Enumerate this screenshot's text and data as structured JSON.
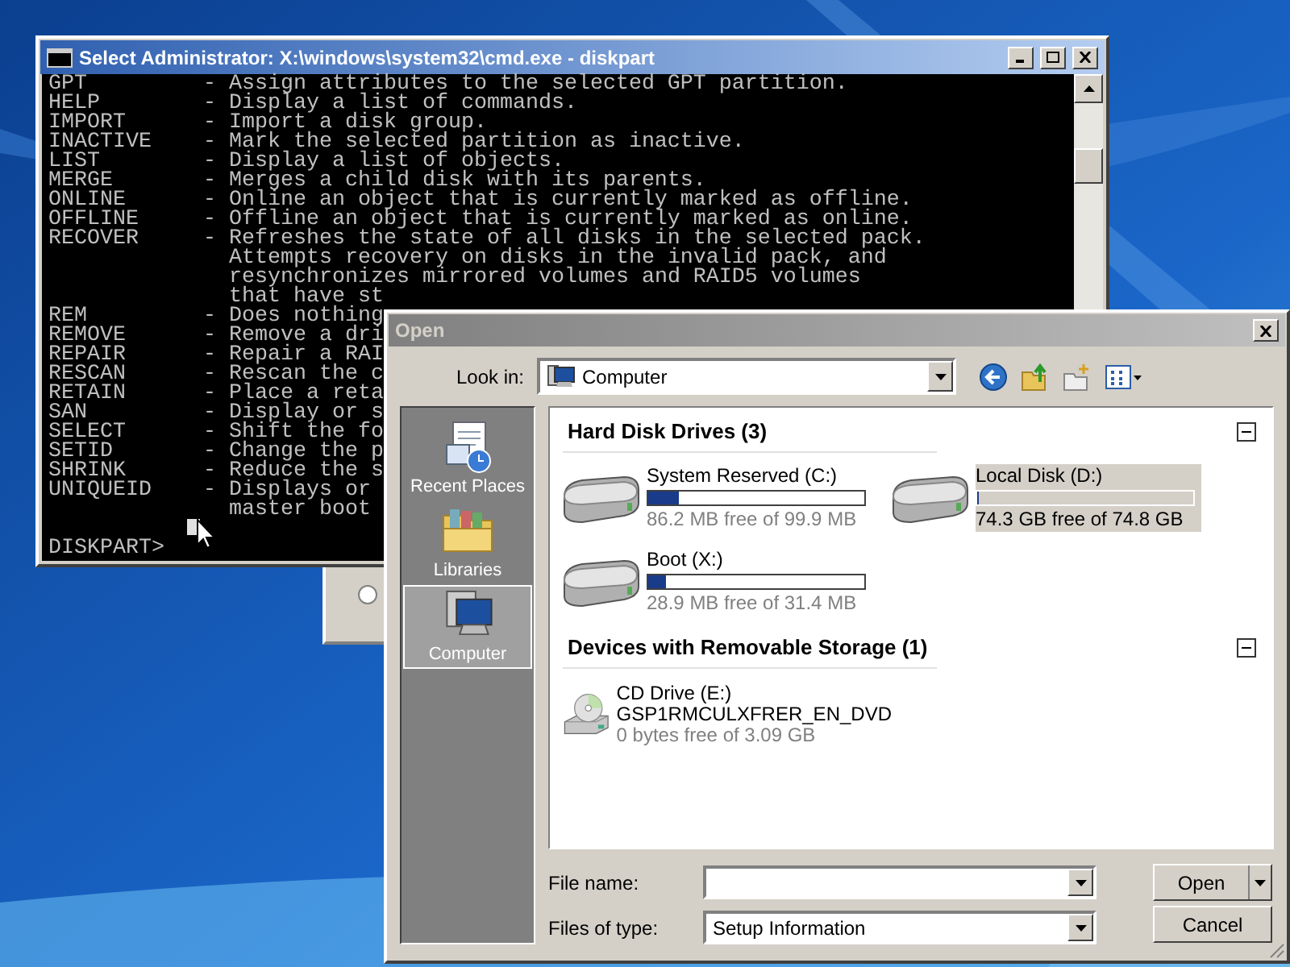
{
  "console": {
    "title": "Select Administrator: X:\\windows\\system32\\cmd.exe - diskpart",
    "lines": [
      {
        "command": "GPT",
        "text": "- Assign attributes to the selected GPT partition."
      },
      {
        "command": "HELP",
        "text": "- Display a list of commands."
      },
      {
        "command": "IMPORT",
        "text": "- Import a disk group."
      },
      {
        "command": "INACTIVE",
        "text": "- Mark the selected partition as inactive."
      },
      {
        "command": "LIST",
        "text": "- Display a list of objects."
      },
      {
        "command": "MERGE",
        "text": "- Merges a child disk with its parents."
      },
      {
        "command": "ONLINE",
        "text": "- Online an object that is currently marked as offline."
      },
      {
        "command": "OFFLINE",
        "text": "- Offline an object that is currently marked as online."
      },
      {
        "command": "RECOVER",
        "text": "- Refreshes the state of all disks in the selected pack."
      },
      {
        "text": "Attempts recovery on disks in the invalid pack, and"
      },
      {
        "text": "resynchronizes mirrored volumes and RAID5 volumes"
      },
      {
        "text": "that have st"
      },
      {
        "command": "REM",
        "text": "- Does nothing"
      },
      {
        "command": "REMOVE",
        "text": "- Remove a dri"
      },
      {
        "command": "REPAIR",
        "text": "- Repair a RAI"
      },
      {
        "command": "RESCAN",
        "text": "- Rescan the c"
      },
      {
        "command": "RETAIN",
        "text": "- Place a reta"
      },
      {
        "command": "SAN",
        "text": "- Display or s"
      },
      {
        "command": "SELECT",
        "text": "- Shift the fo"
      },
      {
        "command": "SETID",
        "text": "- Change the p"
      },
      {
        "command": "SHRINK",
        "text": "- Reduce the s"
      },
      {
        "command": "UNIQUEID",
        "text": "- Displays or"
      },
      {
        "text": "master boot"
      }
    ],
    "prompt": "DISKPART>"
  },
  "background_window": {
    "radio": {
      "selected": false
    }
  },
  "open_dialog": {
    "title": "Open",
    "look_in": {
      "label": "Look in:",
      "value": "Computer"
    },
    "places": [
      {
        "label": "Recent Places",
        "selected": false
      },
      {
        "label": "Libraries",
        "selected": false
      },
      {
        "label": "Computer",
        "selected": true
      }
    ],
    "groups": [
      {
        "heading": "Hard Disk Drives (3)",
        "expanded": true,
        "items": [
          {
            "kind": "hdd",
            "name": "System Reserved (C:)",
            "level": 0.14,
            "free": "86.2 MB free of 99.9 MB",
            "selected": false
          },
          {
            "kind": "hdd",
            "name": "Local Disk (D:)",
            "level": 0.01,
            "free": "74.3 GB free of 74.8 GB",
            "selected": true
          },
          {
            "kind": "hdd",
            "name": "Boot (X:)",
            "level": 0.08,
            "free": "28.9 MB free of 31.4 MB",
            "selected": false
          }
        ]
      },
      {
        "heading": "Devices with Removable Storage (1)",
        "expanded": true,
        "items": [
          {
            "kind": "cd",
            "name": "CD Drive (E:)",
            "label": "GSP1RMCULXFRER_EN_DVD",
            "free": "0 bytes free of 3.09 GB",
            "selected": false
          }
        ]
      }
    ],
    "file_name": {
      "label": "File name:"
    },
    "file_type": {
      "label": "Files of type:",
      "value": "Setup Information"
    },
    "buttons": {
      "open": "Open",
      "cancel": "Cancel"
    }
  }
}
